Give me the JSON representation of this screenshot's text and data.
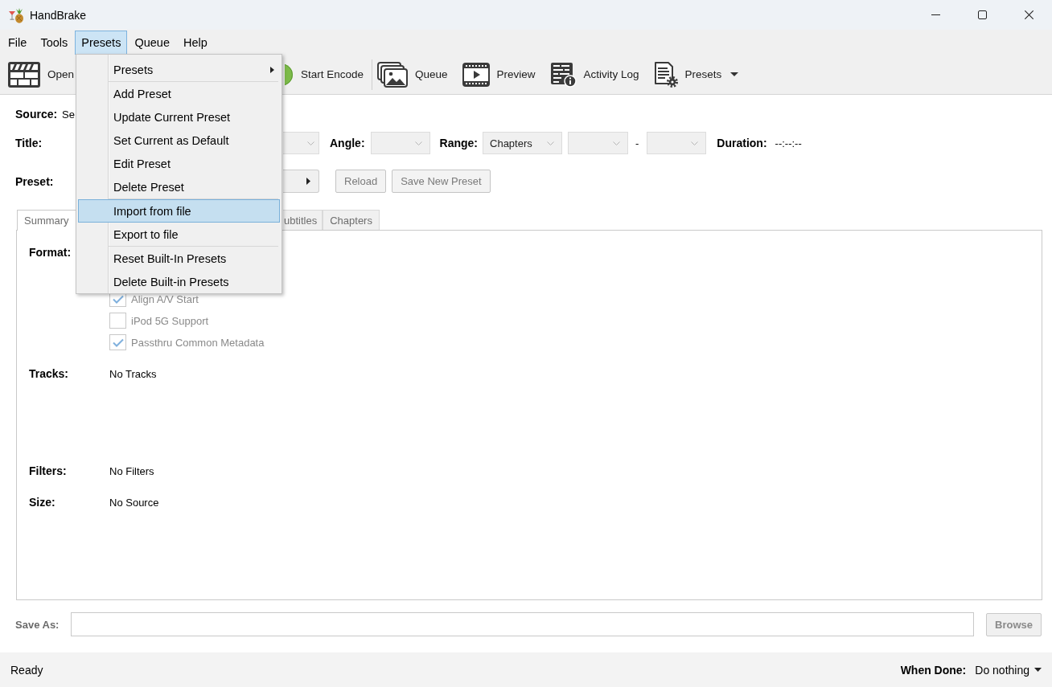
{
  "window": {
    "title": "HandBrake"
  },
  "menu_bar": [
    {
      "label": "File",
      "selected": false
    },
    {
      "label": "Tools",
      "selected": false
    },
    {
      "label": "Presets",
      "selected": true
    },
    {
      "label": "Queue",
      "selected": false
    },
    {
      "label": "Help",
      "selected": false
    }
  ],
  "presets_menu": {
    "groups": [
      [
        {
          "label": "Presets",
          "submenu": true,
          "selected": false
        }
      ],
      [
        {
          "label": "Add Preset",
          "submenu": false,
          "selected": false
        },
        {
          "label": "Update Current Preset",
          "submenu": false,
          "selected": false
        },
        {
          "label": "Set Current as Default",
          "submenu": false,
          "selected": false
        },
        {
          "label": "Edit Preset",
          "submenu": false,
          "selected": false
        },
        {
          "label": "Delete Preset",
          "submenu": false,
          "selected": false
        }
      ],
      [
        {
          "label": "Import from file",
          "submenu": false,
          "selected": true
        },
        {
          "label": "Export to file",
          "submenu": false,
          "selected": false
        }
      ],
      [
        {
          "label": "Reset Built-In Presets",
          "submenu": false,
          "selected": false
        },
        {
          "label": "Delete Built-in Presets",
          "submenu": false,
          "selected": false
        }
      ]
    ]
  },
  "toolbar": {
    "groups": [
      [
        {
          "kind": "source",
          "label": "Open",
          "dropdown": false
        },
        {
          "kind": "encode",
          "label": "Start Encode",
          "dropdown": false
        }
      ],
      [
        {
          "kind": "queue",
          "label": "Queue",
          "dropdown": false
        },
        {
          "kind": "preview",
          "label": "Preview",
          "dropdown": false
        },
        {
          "kind": "log",
          "label": "Activity Log",
          "dropdown": false
        },
        {
          "kind": "presets",
          "label": "Presets",
          "dropdown": true
        }
      ]
    ]
  },
  "source": {
    "label": "Source:",
    "value": "Se"
  },
  "title": {
    "label": "Title:",
    "combo": {
      "disabled": true
    }
  },
  "angle": {
    "label": "Angle:",
    "combo": {
      "disabled": true
    }
  },
  "range": {
    "label": "Range:",
    "mode": {
      "value": "Chapters",
      "disabled": true
    },
    "start": {
      "disabled": true
    },
    "separator": "-",
    "end": {
      "disabled": true
    }
  },
  "duration": {
    "label": "Duration:",
    "value": "--:--:--"
  },
  "preset": {
    "label": "Preset:",
    "buttons": [
      {
        "label": "Reload",
        "disabled": true
      },
      {
        "label": "Save New Preset",
        "disabled": true
      }
    ]
  },
  "tabs": [
    {
      "label": "Summary",
      "selected": true
    },
    {
      "label": "ubtitles",
      "selected": false
    },
    {
      "label": "Chapters",
      "selected": false
    }
  ],
  "summary": {
    "format": {
      "label": "Format:",
      "options": [
        {
          "label": "Align A/V Start",
          "checked": true,
          "disabled": true
        },
        {
          "label": "iPod 5G Support",
          "checked": false,
          "disabled": true
        },
        {
          "label": "Passthru Common Metadata",
          "checked": true,
          "disabled": true
        }
      ]
    },
    "tracks": {
      "label": "Tracks:",
      "value": "No Tracks"
    },
    "filters": {
      "label": "Filters:",
      "value": "No Filters"
    },
    "size": {
      "label": "Size:",
      "value": "No Source"
    }
  },
  "save_as": {
    "label": "Save As:",
    "button": {
      "label": "Browse",
      "disabled": true
    }
  },
  "status_bar": {
    "status": "Ready",
    "when_done": {
      "label": "When Done:",
      "value": "Do nothing"
    }
  }
}
